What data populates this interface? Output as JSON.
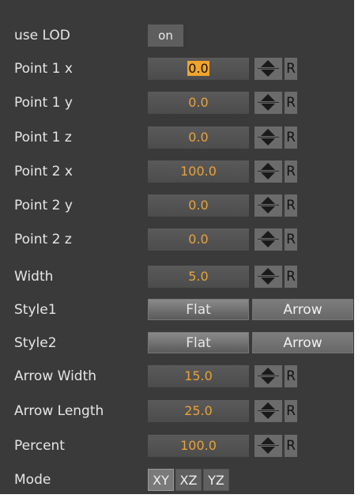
{
  "use_lod": {
    "label": "use LOD",
    "value": "on"
  },
  "fields": [
    {
      "label": "Point 1 x",
      "value": "0.0",
      "focused": true
    },
    {
      "label": "Point 1 y",
      "value": "0.0"
    },
    {
      "label": "Point 1 z",
      "value": "0.0"
    },
    {
      "label": "Point 2 x",
      "value": "100.0"
    },
    {
      "label": "Point 2 y",
      "value": "0.0"
    },
    {
      "label": "Point 2 z",
      "value": "0.0"
    },
    {
      "label": "Width",
      "value": "5.0"
    }
  ],
  "style1": {
    "label": "Style1",
    "options": [
      "Flat",
      "Arrow"
    ],
    "selected": "Flat"
  },
  "style2": {
    "label": "Style2",
    "options": [
      "Flat",
      "Arrow"
    ],
    "selected": "Flat"
  },
  "fields2": [
    {
      "label": "Arrow Width",
      "value": "15.0"
    },
    {
      "label": "Arrow Length",
      "value": "25.0"
    },
    {
      "label": "Percent",
      "value": "100.0"
    }
  ],
  "mode": {
    "label": "Mode",
    "options": [
      "XY",
      "XZ",
      "YZ"
    ],
    "selected": "XY"
  },
  "reset_label": "R",
  "colors": {
    "panel_bg": "#3a3a3a",
    "value_text": "#e8a23a",
    "label_text": "#e6e6e6"
  }
}
